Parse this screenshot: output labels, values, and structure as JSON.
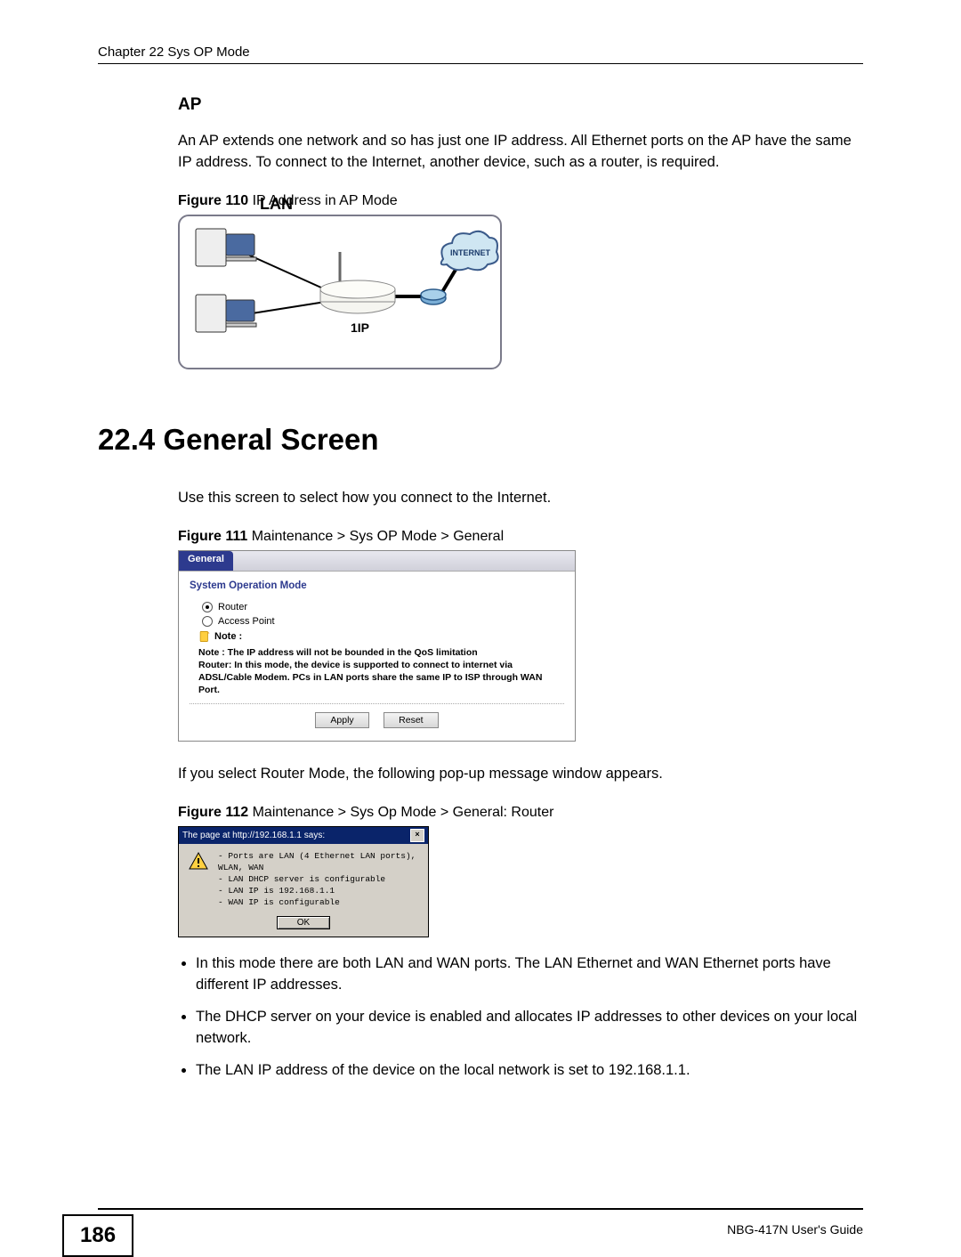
{
  "header": {
    "chapter_line": "Chapter 22 Sys OP Mode"
  },
  "ap_section": {
    "heading": "AP",
    "paragraph": "An AP extends one network and so has just one IP address. All Ethernet ports on the AP have the same IP address. To connect to the Internet, another device, such as a router, is required."
  },
  "figure110": {
    "label_bold": "Figure 110",
    "label_rest": "   IP Address in AP Mode",
    "lan_label": "LAN",
    "ip_label": "1IP",
    "cloud_label": "INTERNET"
  },
  "section224": {
    "number_and_title": "22.4  General Screen",
    "intro": "Use this screen to select how you connect to the Internet."
  },
  "figure111": {
    "label_bold": "Figure 111",
    "label_rest": "   Maintenance > Sys OP Mode > General",
    "tab": "General",
    "group_title": "System Operation Mode",
    "radio_router": "Router",
    "radio_ap": "Access Point",
    "note_label": "Note :",
    "note_line1": "Note : The IP address will not be bounded in the QoS limitation",
    "note_line2": "Router: In this mode, the device is supported to connect to internet via ADSL/Cable Modem. PCs in LAN ports share the same IP to ISP through WAN Port.",
    "apply": "Apply",
    "reset": "Reset"
  },
  "after111": "If you select Router Mode, the following pop-up message window appears.",
  "figure112": {
    "label_bold": "Figure 112",
    "label_rest": "   Maintenance > Sys Op Mode > General: Router",
    "titlebar": "The page at http://192.168.1.1 says:",
    "lines": [
      "Ports are LAN (4 Ethernet LAN ports), WLAN, WAN",
      "LAN DHCP server is configurable",
      "LAN IP is 192.168.1.1",
      "WAN IP is configurable"
    ],
    "ok": "OK"
  },
  "bullets": [
    "In this mode there are both LAN and WAN ports. The LAN Ethernet and WAN Ethernet ports have different IP addresses.",
    "The DHCP server on your device is enabled and allocates IP addresses to other devices on your local network.",
    "The LAN IP address of the device on the local network is set to 192.168.1.1."
  ],
  "footer": {
    "page": "186",
    "guide": "NBG-417N User's Guide"
  }
}
